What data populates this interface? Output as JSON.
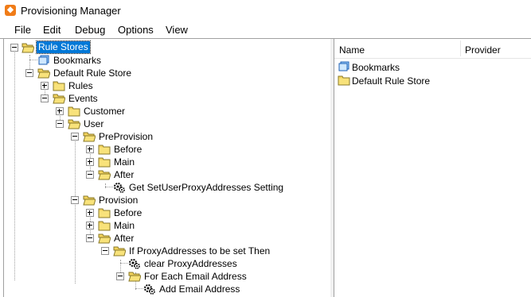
{
  "window": {
    "title": "Provisioning Manager"
  },
  "menu": [
    "File",
    "Edit",
    "Debug",
    "Options",
    "View"
  ],
  "tree": {
    "root": "Rule Stores",
    "bookmarks": "Bookmarks",
    "default_store": "Default Rule Store",
    "rules": "Rules",
    "events": "Events",
    "customer": "Customer",
    "user": "User",
    "preprovision": "PreProvision",
    "pre_before": "Before",
    "pre_main": "Main",
    "pre_after": "After",
    "get_setting": "Get SetUserProxyAddresses Setting",
    "provision": "Provision",
    "prov_before": "Before",
    "prov_main": "Main",
    "prov_after": "After",
    "if_proxy": "If ProxyAddresses to be set Then",
    "clear_proxy": "clear ProxyAddresses",
    "for_each": "For Each Email Address",
    "add_email": "Add Email Address"
  },
  "list": {
    "columns": {
      "name": "Name",
      "provider": "Provider"
    },
    "rows": [
      "Bookmarks",
      "Default Rule Store"
    ]
  },
  "colors": {
    "selection": "#0078d7",
    "folder": "#f3d35c",
    "app_icon": "#f07c18"
  }
}
